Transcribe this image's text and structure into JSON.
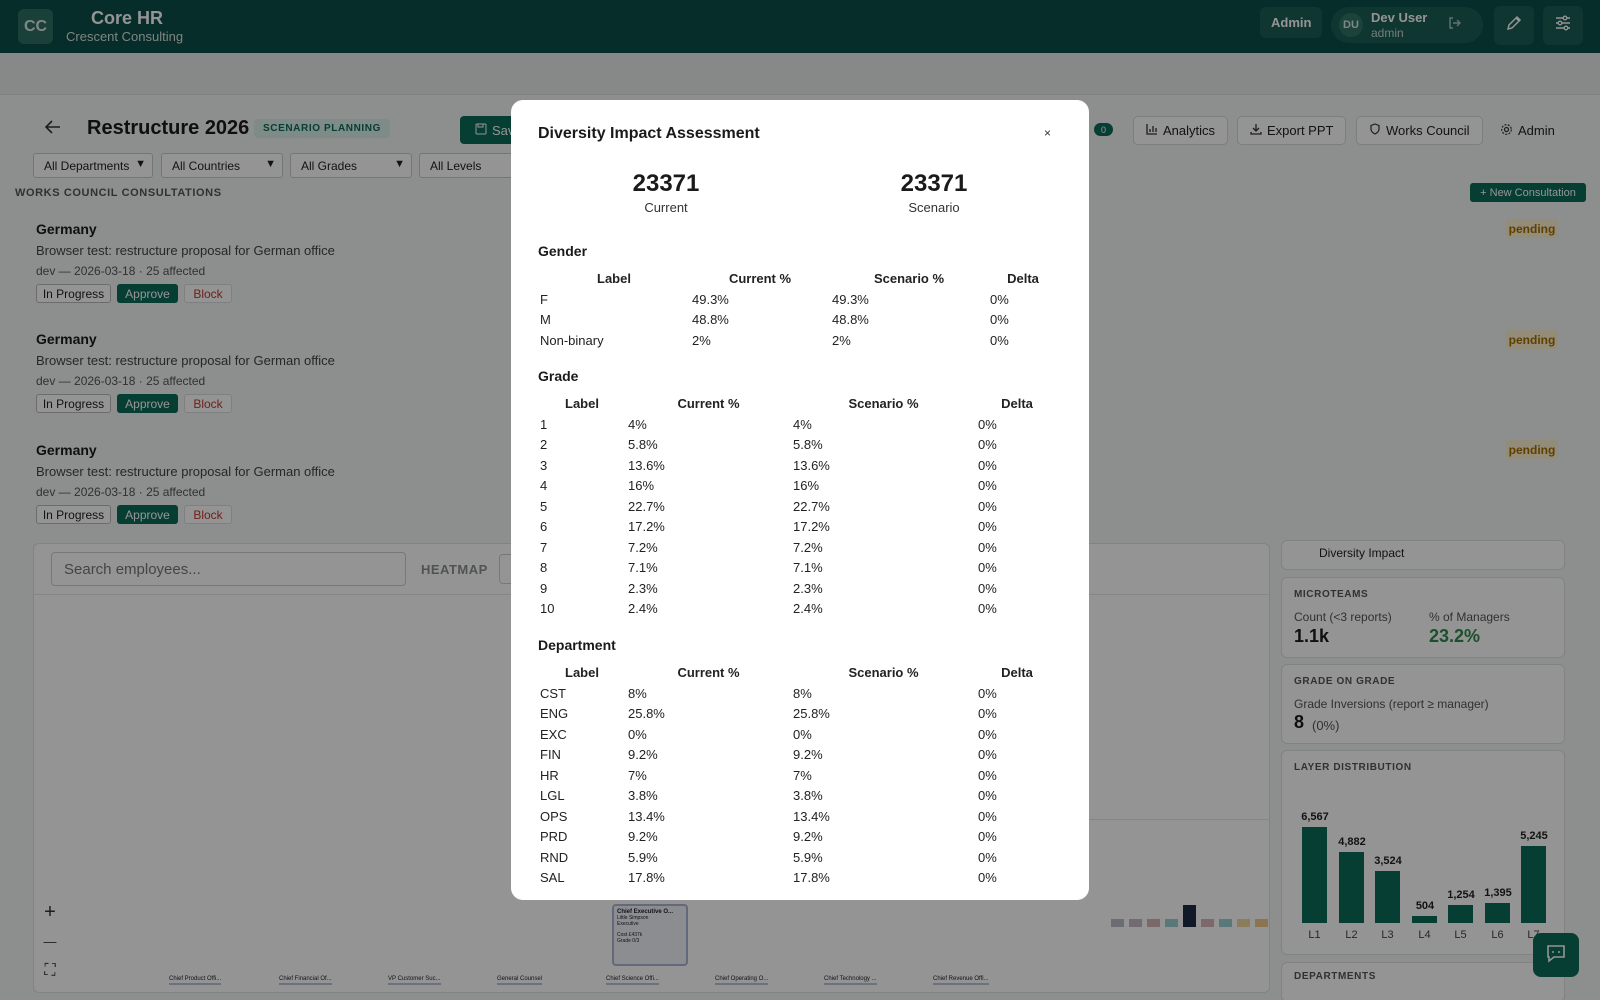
{
  "topbar": {
    "logo": "CC",
    "app_title": "Core HR",
    "org_name": "Crescent Consulting",
    "admin_label": "Admin",
    "user_initials": "DU",
    "user_name": "Dev User",
    "user_role": "admin"
  },
  "page": {
    "title": "Restructure 2026",
    "badge": "SCENARIO PLANNING",
    "save_label": "Sav",
    "count_badge": "0",
    "actions": {
      "analytics": "Analytics",
      "export_ppt": "Export PPT",
      "works_council": "Works Council",
      "admin": "Admin"
    },
    "filters": {
      "departments": "All Departments",
      "countries": "All Countries",
      "grades": "All Grades",
      "levels": "All Levels"
    }
  },
  "works_council": {
    "section_label": "WORKS COUNCIL CONSULTATIONS",
    "new_label": "+ New Consultation",
    "items": [
      {
        "country": "Germany",
        "description": "Browser test: restructure proposal for German office",
        "meta": "dev — 2026-03-18 · 25 affected",
        "status": "pending",
        "in_progress": "In Progress",
        "approve": "Approve",
        "block": "Block"
      },
      {
        "country": "Germany",
        "description": "Browser test: restructure proposal for German office",
        "meta": "dev — 2026-03-18 · 25 affected",
        "status": "pending",
        "in_progress": "In Progress",
        "approve": "Approve",
        "block": "Block"
      },
      {
        "country": "Germany",
        "description": "Browser test: restructure proposal for German office",
        "meta": "dev — 2026-03-18 · 25 affected",
        "status": "pending",
        "in_progress": "In Progress",
        "approve": "Approve",
        "block": "Block"
      }
    ]
  },
  "org_panel": {
    "search_placeholder": "Search employees...",
    "heatmap_label": "HEATMAP",
    "zoom_in": "+",
    "zoom_out": "—",
    "fit": "⛶",
    "node": {
      "name": "Chief Executive O...",
      "sub": "Little Simpson",
      "role": "Executive",
      "cost": "Cost £437k",
      "grade": "Grade 0/3"
    },
    "bottom_nodes": [
      "Chief Product Offi...",
      "Chief Financial Of...",
      "VP Customer Suc...",
      "General Counsel",
      "Chief Science Offi...",
      "Chief Operating O...",
      "Chief Technology ...",
      "Chief Revenue Offi..."
    ]
  },
  "side": {
    "diversity_tab": "Diversity Impact",
    "microteams": {
      "label": "MICROTEAMS",
      "count_label": "Count (<3 reports)",
      "count_value": "1.1k",
      "managers_label": "% of Managers",
      "managers_value": "23.2%"
    },
    "grade_on_grade": {
      "label": "GRADE ON GRADE",
      "inversions_label": "Grade Inversions (report ≥ manager)",
      "value": "8",
      "pct": "(0%)"
    },
    "layer_distribution": {
      "label": "LAYER DISTRIBUTION",
      "layers": [
        {
          "name": "L1",
          "count": 6567,
          "count_label": "6,567"
        },
        {
          "name": "L2",
          "count": 4882,
          "count_label": "4,882"
        },
        {
          "name": "L3",
          "count": 3524,
          "count_label": "3,524"
        },
        {
          "name": "L4",
          "count": 504,
          "count_label": "504"
        },
        {
          "name": "L5",
          "count": 1254,
          "count_label": "1,254"
        },
        {
          "name": "L6",
          "count": 1395,
          "count_label": "1,395"
        },
        {
          "name": "L7",
          "count": 5245,
          "count_label": "5,245"
        }
      ]
    },
    "departments_label": "DEPARTMENTS"
  },
  "modal": {
    "title": "Diversity Impact Assessment",
    "close": "×",
    "current_value": "23371",
    "current_label": "Current",
    "scenario_value": "23371",
    "scenario_label": "Scenario",
    "columns": [
      "Label",
      "Current %",
      "Scenario %",
      "Delta"
    ],
    "gender": {
      "title": "Gender",
      "rows": [
        [
          "F",
          "49.3%",
          "49.3%",
          "0%"
        ],
        [
          "M",
          "48.8%",
          "48.8%",
          "0%"
        ],
        [
          "Non-binary",
          "2%",
          "2%",
          "0%"
        ]
      ]
    },
    "grade": {
      "title": "Grade",
      "rows": [
        [
          "1",
          "4%",
          "4%",
          "0%"
        ],
        [
          "2",
          "5.8%",
          "5.8%",
          "0%"
        ],
        [
          "3",
          "13.6%",
          "13.6%",
          "0%"
        ],
        [
          "4",
          "16%",
          "16%",
          "0%"
        ],
        [
          "5",
          "22.7%",
          "22.7%",
          "0%"
        ],
        [
          "6",
          "17.2%",
          "17.2%",
          "0%"
        ],
        [
          "7",
          "7.2%",
          "7.2%",
          "0%"
        ],
        [
          "8",
          "7.1%",
          "7.1%",
          "0%"
        ],
        [
          "9",
          "2.3%",
          "2.3%",
          "0%"
        ],
        [
          "10",
          "2.4%",
          "2.4%",
          "0%"
        ]
      ]
    },
    "department": {
      "title": "Department",
      "rows": [
        [
          "CST",
          "8%",
          "8%",
          "0%"
        ],
        [
          "ENG",
          "25.8%",
          "25.8%",
          "0%"
        ],
        [
          "EXC",
          "0%",
          "0%",
          "0%"
        ],
        [
          "FIN",
          "9.2%",
          "9.2%",
          "0%"
        ],
        [
          "HR",
          "7%",
          "7%",
          "0%"
        ],
        [
          "LGL",
          "3.8%",
          "3.8%",
          "0%"
        ],
        [
          "OPS",
          "13.4%",
          "13.4%",
          "0%"
        ],
        [
          "PRD",
          "9.2%",
          "9.2%",
          "0%"
        ],
        [
          "RND",
          "5.9%",
          "5.9%",
          "0%"
        ],
        [
          "SAL",
          "17.8%",
          "17.8%",
          "0%"
        ]
      ]
    }
  },
  "colors": {
    "brand": "#0c4f47",
    "accent": "#0c6b5b",
    "pending_bg": "#fdf1cf",
    "pending_text": "#a36d00",
    "positive": "#2f8a4d"
  }
}
